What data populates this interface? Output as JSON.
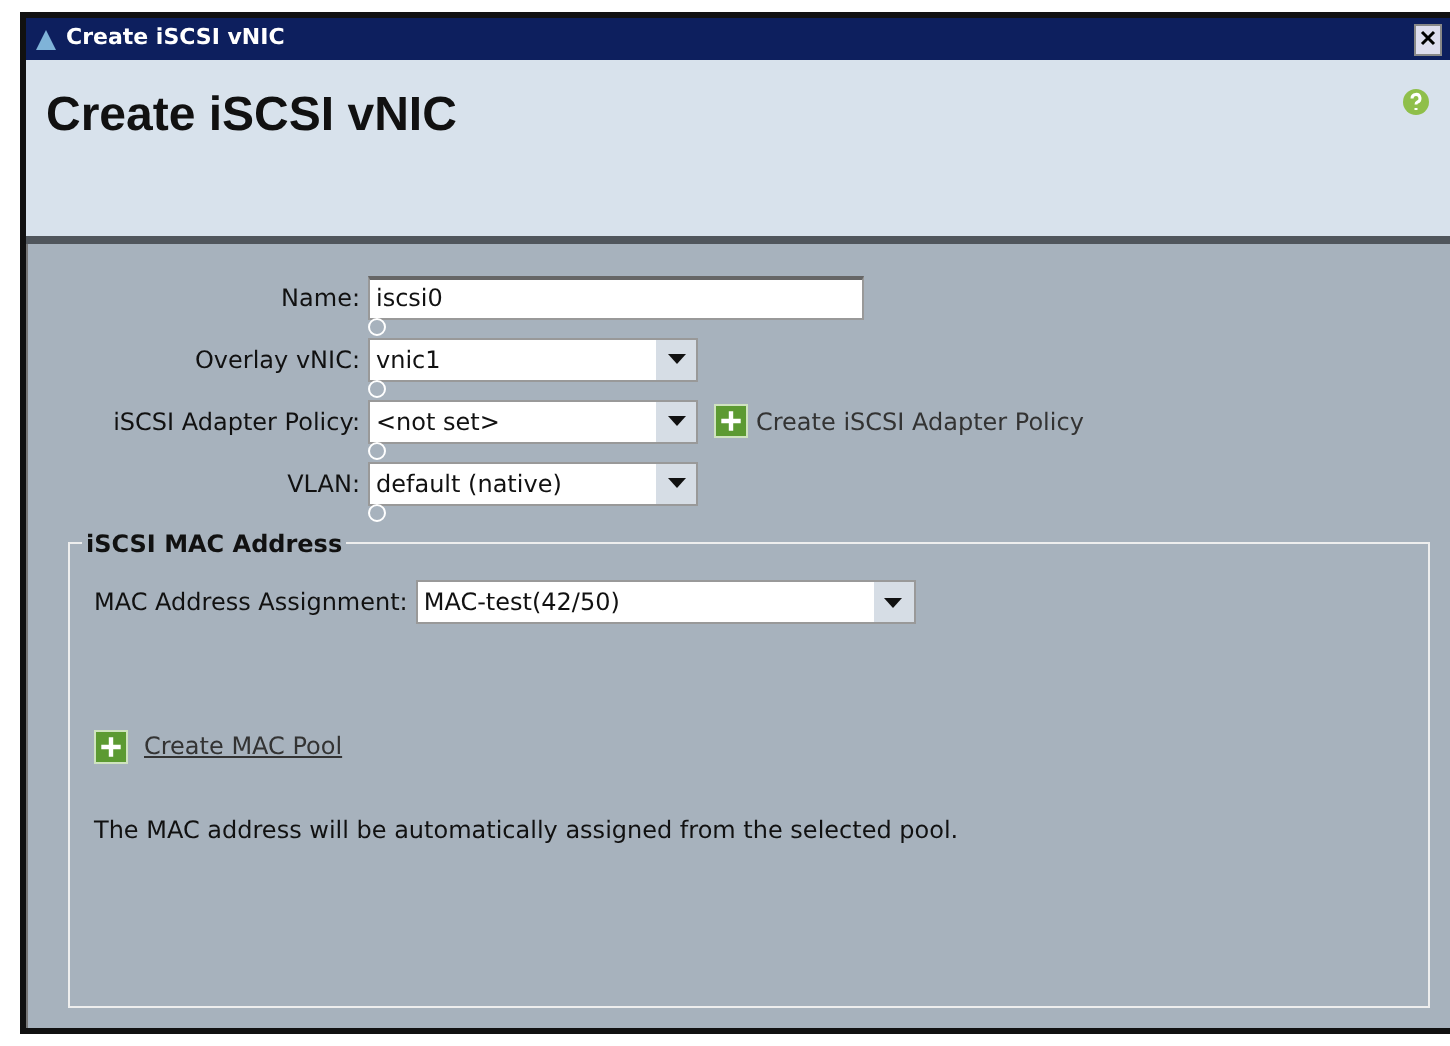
{
  "window": {
    "title": "Create iSCSI vNIC"
  },
  "header": {
    "title": "Create iSCSI vNIC"
  },
  "fields": [
    {
      "kind": "text",
      "label": "Name:",
      "value": "iscsi0"
    },
    {
      "kind": "select",
      "label": "Overlay vNIC:",
      "value": "vnic1"
    },
    {
      "kind": "select",
      "label": "iSCSI Adapter Policy:",
      "value": "<not set>",
      "action": "Create iSCSI Adapter Policy"
    },
    {
      "kind": "select",
      "label": "VLAN:",
      "value": "default (native)"
    }
  ],
  "mac_group": {
    "legend": "iSCSI MAC Address",
    "assignment_label": "MAC Address Assignment:",
    "assignment_value": "MAC-test(42/50)",
    "create_link": "Create MAC Pool",
    "note": "The MAC address will be automatically assigned from the selected pool."
  }
}
